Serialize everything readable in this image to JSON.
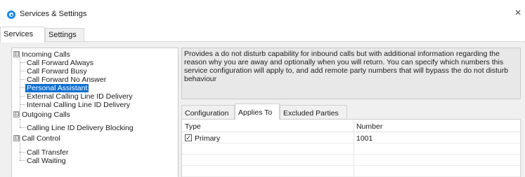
{
  "window": {
    "title": "Services & Settings",
    "close_glyph": "×"
  },
  "tabs": [
    {
      "label": "Services",
      "active": true
    },
    {
      "label": "Settings",
      "active": false
    }
  ],
  "tree": {
    "groups": [
      {
        "label": "Incoming Calls",
        "expander": "⊟",
        "items": [
          {
            "label": "Call Forward Always"
          },
          {
            "label": "Call Forward Busy"
          },
          {
            "label": "Call Forward No Answer"
          },
          {
            "label": "Personal Assistant",
            "selected": true
          },
          {
            "label": "External Calling Line ID Delivery"
          },
          {
            "label": "Internal Calling Line ID Delivery"
          }
        ]
      },
      {
        "label": "Outgoing Calls",
        "expander": "⊟",
        "items": [
          {
            "label": "Calling Line ID Delivery Blocking"
          }
        ]
      },
      {
        "label": "Call Control",
        "expander": "⊟",
        "items": [
          {
            "label": "Call Transfer"
          },
          {
            "label": "Call Waiting"
          }
        ]
      }
    ]
  },
  "description": "Provides a do not disturb capability for inbound calls but with additional information regarding the reason why you are away and optionally when you will return. You can specify which numbers this service configuration will apply to, and add remote party numbers that will bypass the do not disturb behaviour",
  "subtabs": [
    {
      "label": "Configuration",
      "active": false
    },
    {
      "label": "Applies To",
      "active": true
    },
    {
      "label": "Excluded Parties",
      "active": false
    }
  ],
  "grid": {
    "columns": [
      "Type",
      "Number"
    ],
    "rows": [
      {
        "checked": true,
        "check_glyph": "✓",
        "type": "Primary",
        "number": "1001"
      }
    ]
  },
  "colors": {
    "selection": "#0f6fd1",
    "app_icon": "#1e88e5"
  }
}
